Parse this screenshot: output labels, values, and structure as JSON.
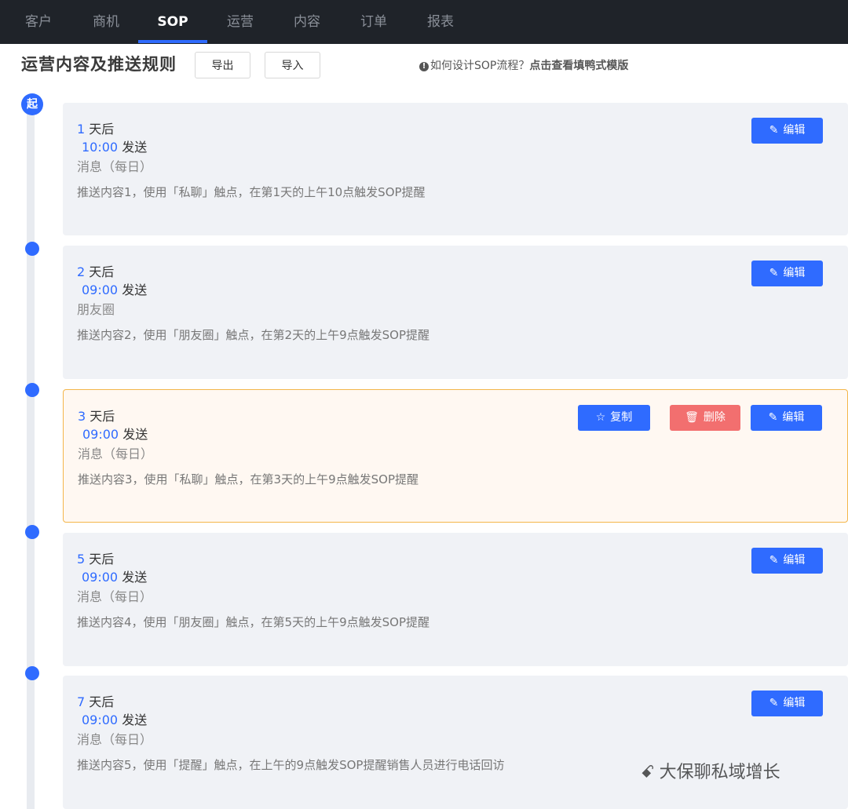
{
  "nav": {
    "tabs": [
      "客户",
      "商机",
      "SOP",
      "运营",
      "内容",
      "订单",
      "报表"
    ],
    "active": "SOP"
  },
  "header": {
    "title": "运营内容及推送规则",
    "export_label": "导出",
    "import_label": "导入",
    "help_text": "如何设计SOP流程？",
    "help_link": "点击查看填鸭式模版"
  },
  "timeline": {
    "start_label": "起"
  },
  "steps": [
    {
      "day": "1",
      "day_suffix": " 天后",
      "time": "10:00",
      "send": " 发送",
      "kind": "消息（每日）",
      "desc": "推送内容1，使用「私聊」触点，在第1天的上午10点触发SOP提醒"
    },
    {
      "day": "2",
      "day_suffix": " 天后",
      "time": "09:00",
      "send": " 发送",
      "kind": "朋友圈",
      "desc": "推送内容2，使用「朋友圈」触点，在第2天的上午9点触发SOP提醒"
    },
    {
      "day": "3",
      "day_suffix": " 天后",
      "time": "09:00",
      "send": " 发送",
      "kind": "消息（每日）",
      "desc": "推送内容3，使用「私聊」触点，在第3天的上午9点触发SOP提醒"
    },
    {
      "day": "5",
      "day_suffix": " 天后",
      "time": "09:00",
      "send": " 发送",
      "kind": "消息（每日）",
      "desc": "推送内容4，使用「朋友圈」触点，在第5天的上午9点触发SOP提醒"
    },
    {
      "day": "7",
      "day_suffix": " 天后",
      "time": "09:00",
      "send": " 发送",
      "kind": "消息（每日）",
      "desc": "推送内容5，使用「提醒」触点，在上午的9点触发SOP提醒销售人员进行电话回访"
    }
  ],
  "actions": {
    "edit": "编辑",
    "copy": "复制",
    "delete": "删除"
  },
  "watermark": "大保聊私域增长",
  "colors": {
    "accent": "#2f6bff",
    "danger": "#f26f6f",
    "highlight_border": "#f4b64a",
    "nav_bg": "#1f2329"
  }
}
